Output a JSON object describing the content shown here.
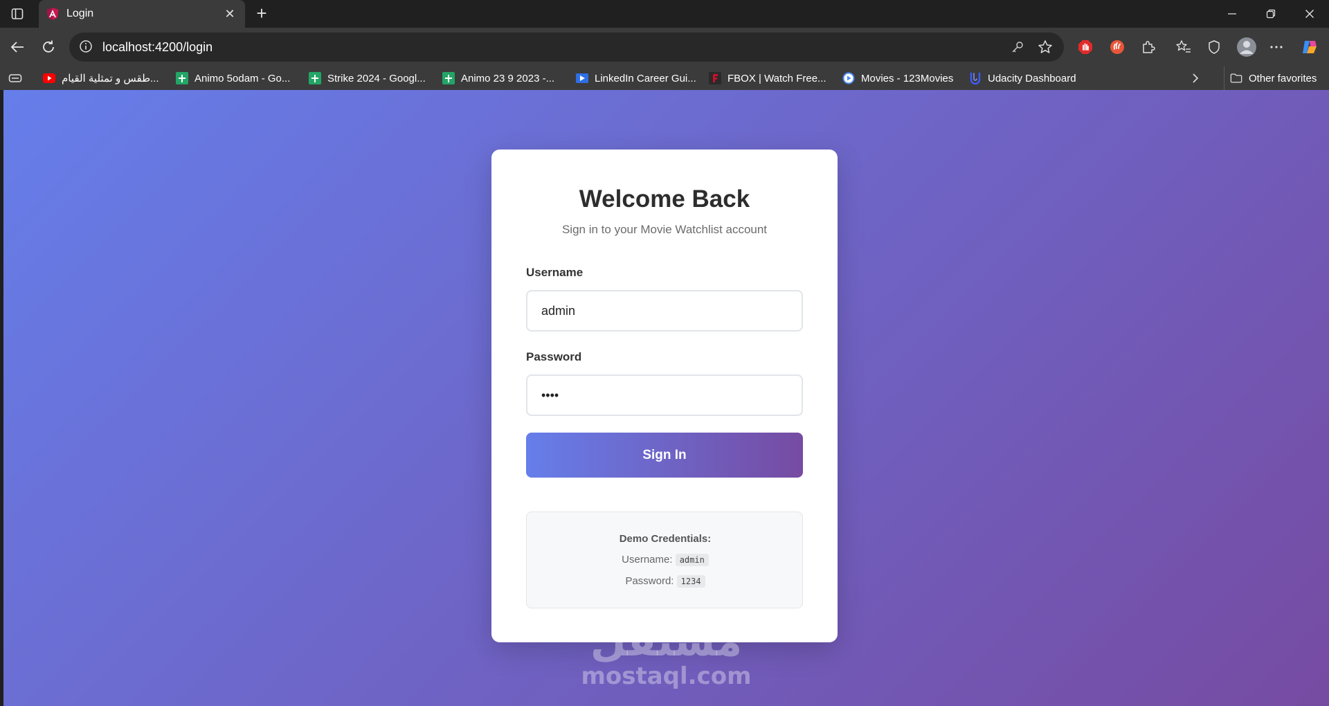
{
  "browser": {
    "tab_title": "Login",
    "url": "localhost:4200/login"
  },
  "bookmarks": [
    {
      "label": "طقس و تمثلية القيام...",
      "icon": "youtube-icon",
      "color": "#ff0000"
    },
    {
      "label": "Animo 5odam - Go...",
      "icon": "google-sheets-icon",
      "color": "#23a566"
    },
    {
      "label": "Strike 2024 - Googl...",
      "icon": "google-sheets-icon",
      "color": "#23a566"
    },
    {
      "label": "Animo 23 9 2023 -...",
      "icon": "google-sheets-icon",
      "color": "#23a566"
    },
    {
      "label": "LinkedIn Career Gui...",
      "icon": "video-icon",
      "color": "#2f6fe4"
    },
    {
      "label": "FBOX | Watch Free...",
      "icon": "fbox-icon",
      "color": "#c8102e"
    },
    {
      "label": "Movies - 123Movies",
      "icon": "play-circle-icon",
      "color": "#4a8bf5"
    },
    {
      "label": "Udacity Dashboard",
      "icon": "udacity-icon",
      "color": "#3d5afe"
    }
  ],
  "other_favorites": "Other favorites",
  "login": {
    "title": "Welcome Back",
    "subtitle": "Sign in to your Movie Watchlist account",
    "username_label": "Username",
    "username_value": "admin",
    "password_label": "Password",
    "password_value": "••••",
    "submit_label": "Sign In",
    "demo": {
      "title": "Demo Credentials:",
      "username_label": "Username:",
      "username_value": "admin",
      "password_label": "Password:",
      "password_value": "1234"
    }
  },
  "watermark": {
    "arabic": "مستقل",
    "latin": "mostaql.com"
  }
}
